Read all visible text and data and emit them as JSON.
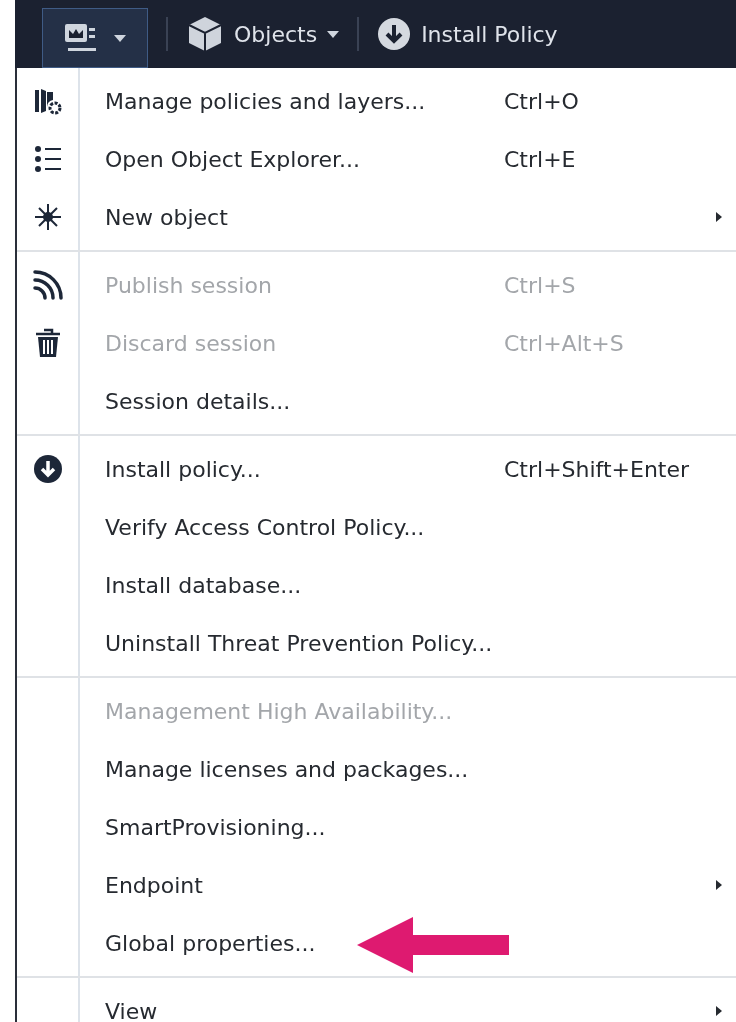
{
  "toolbar": {
    "items": [
      {
        "kind": "menu-button",
        "selected": true
      },
      {
        "kind": "dropdown",
        "label": "Objects"
      },
      {
        "kind": "action",
        "label": "Install Policy"
      }
    ]
  },
  "menu": {
    "groups": [
      {
        "items": [
          {
            "label": "Manage policies and layers...",
            "shortcut": "Ctrl+O",
            "disabled": false,
            "submenu": false
          },
          {
            "label": "Open Object Explorer...",
            "shortcut": "Ctrl+E",
            "disabled": false,
            "submenu": false
          },
          {
            "label": "New object",
            "disabled": false,
            "submenu": true
          }
        ]
      },
      {
        "items": [
          {
            "label": "Publish session",
            "shortcut": "Ctrl+S",
            "disabled": true,
            "submenu": false
          },
          {
            "label": "Discard session",
            "shortcut": "Ctrl+Alt+S",
            "disabled": true,
            "submenu": false
          },
          {
            "label": "Session details...",
            "disabled": false,
            "submenu": false
          }
        ]
      },
      {
        "items": [
          {
            "label": "Install policy...",
            "shortcut": "Ctrl+Shift+Enter",
            "disabled": false,
            "submenu": false
          },
          {
            "label": "Verify Access Control Policy...",
            "disabled": false,
            "submenu": false
          },
          {
            "label": "Install database...",
            "disabled": false,
            "submenu": false
          },
          {
            "label": "Uninstall Threat Prevention Policy...",
            "disabled": false,
            "submenu": false
          }
        ]
      },
      {
        "items": [
          {
            "label": "Management High Availability...",
            "disabled": true,
            "submenu": false
          },
          {
            "label": "Manage licenses and packages...",
            "disabled": false,
            "submenu": false
          },
          {
            "label": "SmartProvisioning...",
            "disabled": false,
            "submenu": false
          },
          {
            "label": "Endpoint",
            "disabled": false,
            "submenu": true
          },
          {
            "label": "Global properties...",
            "disabled": false,
            "submenu": false,
            "annotated": true
          }
        ]
      },
      {
        "items": [
          {
            "label": "View",
            "disabled": false,
            "submenu": true
          }
        ]
      }
    ]
  }
}
